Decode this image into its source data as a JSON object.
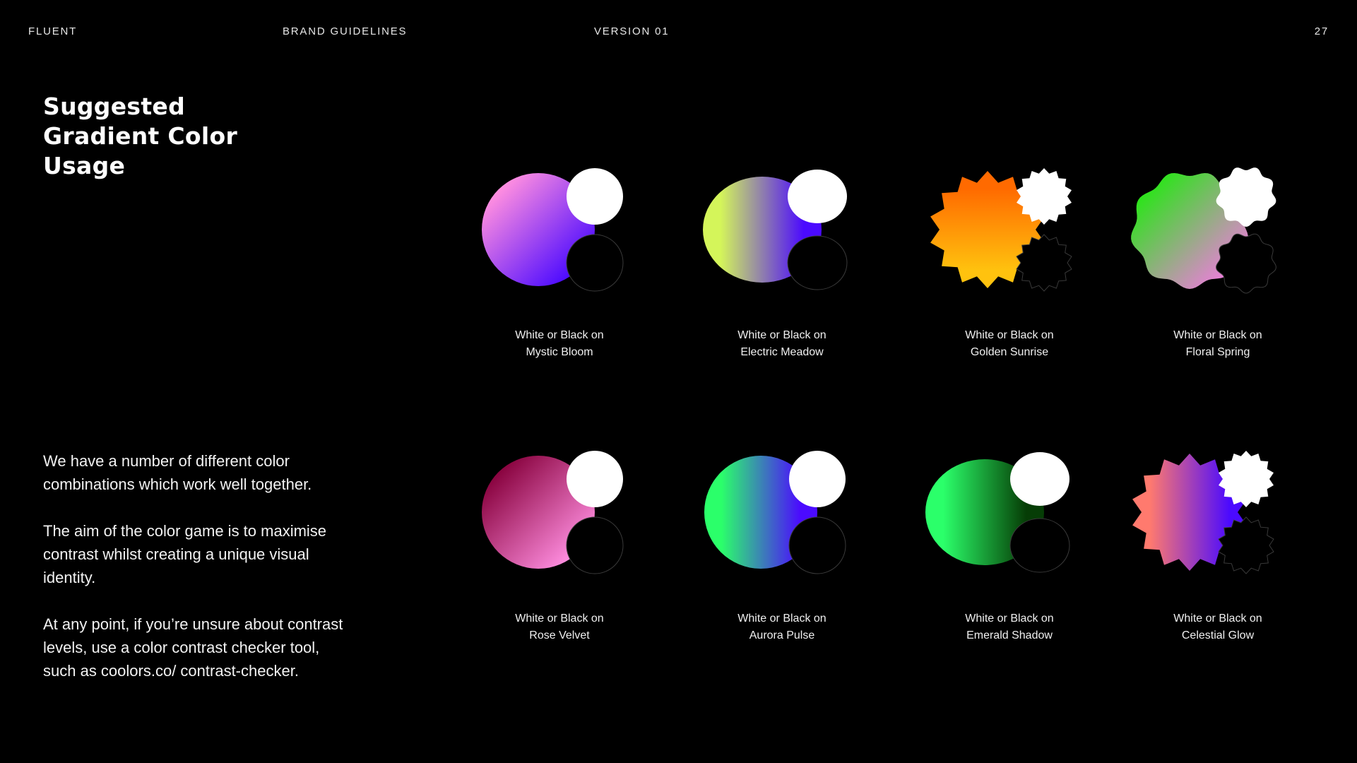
{
  "header": {
    "brand": "FLUENT",
    "section": "BRAND GUIDELINES",
    "version": "VERSION 01",
    "page_number": "27"
  },
  "title_lines": [
    "Suggested",
    "Gradient Color",
    "Usage"
  ],
  "paragraphs": [
    "We have a number of different color combinations which work well together.",
    "The aim of the color game is to maximise contrast whilst creating a unique visual identity.",
    "At any point, if you’re unsure about contrast levels, use a color contrast checker tool, such as coolors.co/ contrast-checker."
  ],
  "swatches": [
    {
      "line1": "White or Black on",
      "name": "Mystic Bloom",
      "shape": "circle",
      "colors": [
        "#ff8ee0",
        "#4b0aff"
      ]
    },
    {
      "line1": "White or Black on",
      "name": "Electric Meadow",
      "shape": "oval",
      "colors": [
        "#d4f55a",
        "#4b0aff"
      ]
    },
    {
      "line1": "White or Black on",
      "name": "Golden Sunrise",
      "shape": "starburst",
      "colors": [
        "#ff6a00",
        "#ffc20e"
      ]
    },
    {
      "line1": "White or Black on",
      "name": "Floral Spring",
      "shape": "wavy",
      "colors": [
        "#2ee31c",
        "#ea7fd9"
      ]
    },
    {
      "line1": "White or Black on",
      "name": "Rose Velvet",
      "shape": "circle",
      "colors": [
        "#8a0440",
        "#ff8ee0"
      ]
    },
    {
      "line1": "White or Black on",
      "name": "Aurora Pulse",
      "shape": "circle",
      "colors": [
        "#2bff6a",
        "#4b0aff"
      ]
    },
    {
      "line1": "White or Black on",
      "name": "Emerald Shadow",
      "shape": "oval",
      "colors": [
        "#2bff6a",
        "#063d06"
      ]
    },
    {
      "line1": "White or Black on",
      "name": "Celestial Glow",
      "shape": "starburst",
      "colors": [
        "#ff7a6e",
        "#4b0aff"
      ]
    }
  ]
}
